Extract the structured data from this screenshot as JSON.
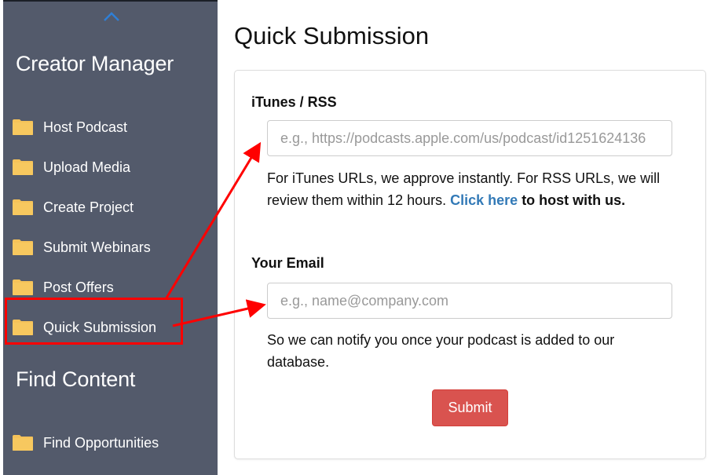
{
  "sidebar": {
    "collapse_icon": "chevron-up-icon",
    "sections": [
      {
        "heading": "Creator Manager",
        "items": [
          {
            "label": "Host Podcast",
            "icon": "folder-icon"
          },
          {
            "label": "Upload Media",
            "icon": "folder-icon"
          },
          {
            "label": "Create Project",
            "icon": "folder-icon"
          },
          {
            "label": "Submit Webinars",
            "icon": "folder-icon"
          },
          {
            "label": "Post Offers",
            "icon": "folder-icon"
          },
          {
            "label": "Quick Submission",
            "icon": "folder-icon",
            "highlighted": true
          }
        ]
      },
      {
        "heading": "Find Content",
        "items": [
          {
            "label": "Find Opportunities",
            "icon": "folder-icon"
          }
        ]
      }
    ]
  },
  "main": {
    "title": "Quick Submission",
    "form": {
      "itunes_label": "iTunes / RSS",
      "itunes_placeholder": "e.g., https://podcasts.apple.com/us/podcast/id1251624136",
      "itunes_value": "",
      "itunes_help": {
        "text": "For iTunes URLs, we approve instantly. For RSS URLs, we will review them within 12 hours.",
        "link": "Click here",
        "after_link": "to host with us."
      },
      "email_label": "Your Email",
      "email_placeholder": "e.g., name@company.com",
      "email_value": "",
      "email_help": "So we can notify you once your podcast is added to our database.",
      "submit_label": "Submit"
    }
  },
  "annotations": {
    "color": "#ff0000",
    "highlight_target": "Quick Submission",
    "arrows_to": [
      "itunes-rss-input",
      "email-input"
    ]
  },
  "colors": {
    "sidebar_bg": "#535a6b",
    "folder": "#f5c259",
    "link": "#337ab7",
    "submit": "#d9534f",
    "chevron": "#2f7fd6"
  }
}
